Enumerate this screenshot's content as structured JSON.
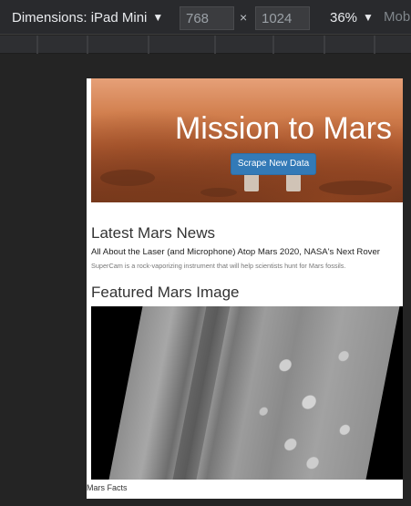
{
  "devtools": {
    "dimensions_label": "Dimensions: iPad Mini",
    "width_value": "768",
    "height_value": "1024",
    "times_symbol": "×",
    "zoom": "36%",
    "mode": "Mob",
    "dropdown_glyph": "▼"
  },
  "hero": {
    "title": "Mission to Mars",
    "button_label": "Scrape New Data",
    "button_color": "#337ab7"
  },
  "news": {
    "heading": "Latest Mars News",
    "title": "All About the Laser (and Microphone) Atop Mars 2020, NASA's Next Rover",
    "paragraph": "SuperCam is a rock-vaporizing instrument that will help scientists hunt for Mars fossils."
  },
  "featured_image": {
    "heading": "Featured Mars Image"
  },
  "facts": {
    "heading": "Mars Facts"
  }
}
